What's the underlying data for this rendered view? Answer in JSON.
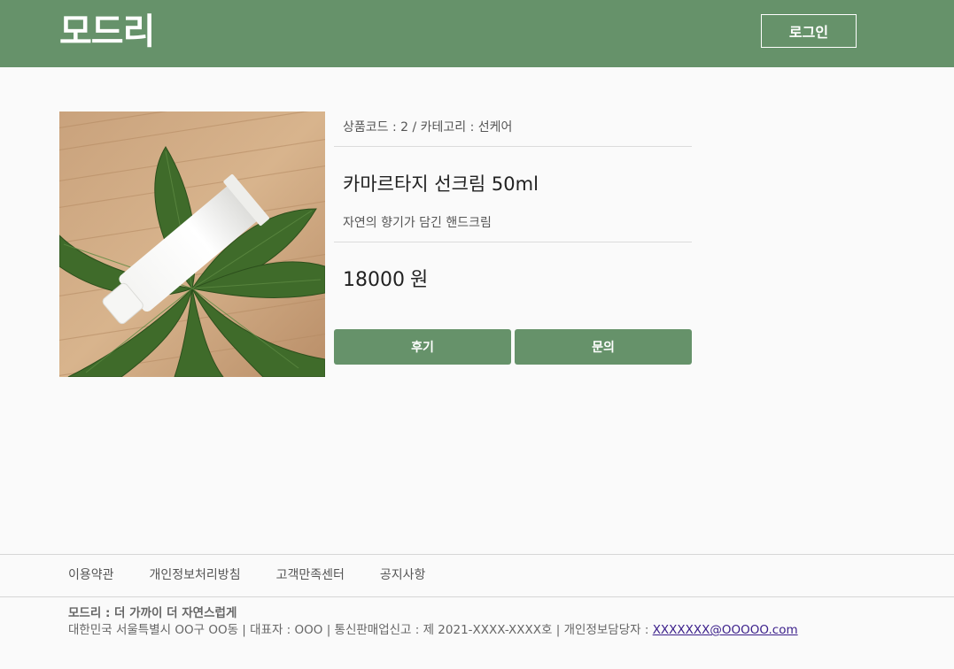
{
  "header": {
    "logo": "모드리",
    "login_label": "로그인"
  },
  "product": {
    "meta": "상품코드 : 2 / 카테고리 : 선케어",
    "title": "카마르타지 선크림 50ml",
    "description": "자연의 향기가 담긴 핸드크림",
    "price": "18000",
    "currency": "원",
    "image_icon": "sunscreen-tube-on-leaves-image"
  },
  "actions": {
    "review_label": "후기",
    "inquiry_label": "문의"
  },
  "footer": {
    "nav": [
      "이용약관",
      "개인정보처리방침",
      "고객만족센터",
      "공지사항"
    ],
    "slogan": "모드리 : 더 가까이 더 자연스럽게",
    "info_prefix": "대한민국 서울특별시 OO구 OO동 | 대표자 : OOO | 통신판매업신고 : 제 2021-XXXX-XXXX호 | 개인정보담당자 : ",
    "email": "XXXXXXX@OOOOO.com"
  },
  "colors": {
    "brand_green": "#66926a",
    "background": "#fafafa",
    "link": "#3a1e8a"
  }
}
